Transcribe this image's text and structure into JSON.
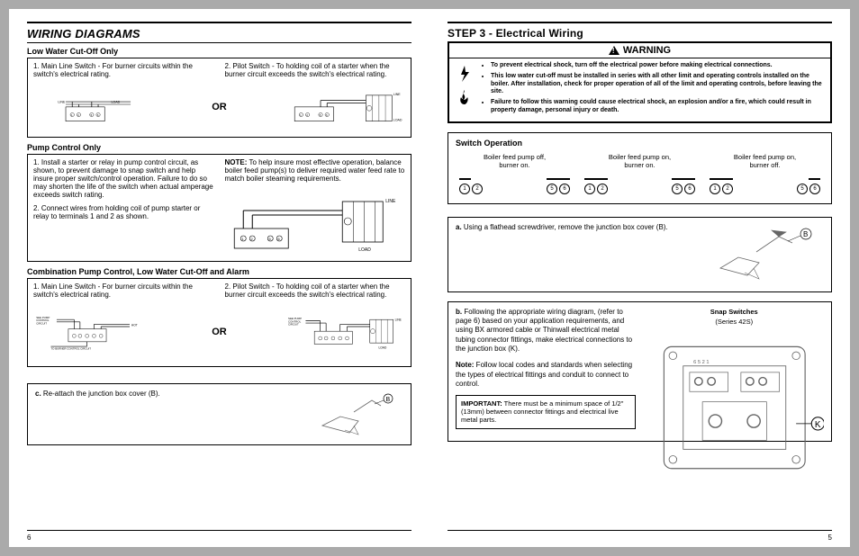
{
  "left": {
    "heading": "WIRING DIAGRAMS",
    "sec1": {
      "title": "Low Water Cut-Off Only",
      "item1": "1. Main Line Switch - For burner circuits within the switch's electrical rating.",
      "or": "OR",
      "item2": "2. Pilot Switch - To holding coil of a starter when the burner circuit exceeds the switch's electrical rating.",
      "d1_labels": {
        "line": "LINE",
        "load": "LOAD",
        "terms": "1 2     5 6"
      },
      "d2_labels": {
        "line": "LINE",
        "load": "LOAD",
        "terms": "1 2     5 6"
      }
    },
    "sec2": {
      "title": "Pump Control Only",
      "item1": "1. Install a starter or relay in pump control circuit, as shown, to prevent damage to snap switch and help insure proper switch/control operation. Failure to do so may shorten the life of the switch when actual amperage exceeds switch rating.",
      "item2": "2. Connect wires from holding coil of pump starter or relay to terminals 1 and 2 as shown.",
      "note_label": "NOTE:",
      "note": " To help insure most effective operation, balance boiler feed pump(s) to deliver required water feed rate to match boiler steaming requirements.",
      "d_labels": {
        "line": "LINE",
        "load": "LOAD",
        "terms": "1 2     5 6"
      }
    },
    "sec3": {
      "title": "Combination Pump Control, Low Water Cut-Off and Alarm",
      "item1": "1. Main Line Switch - For burner circuits within the switch's electrical rating.",
      "or": "OR",
      "item2": "2. Pilot Switch  - To holding coil of a starter when the burner circuit exceeds the switch's electrical rating.",
      "d1_labels": {
        "see": "SEE PUMP CONTROL CIRCUIT",
        "hot": "HOT",
        "to": "TO BURNER CONTROL CIRCUIT"
      },
      "d2_labels": {
        "see": "SEE PUMP CONTROL CIRCUIT",
        "line": "LINE",
        "load": "LOAD"
      }
    },
    "step_c": "c. Re-attach the junction box cover (B).",
    "page_num": "6"
  },
  "right": {
    "heading": "STEP 3 - Electrical Wiring",
    "warning_title": "WARNING",
    "warn1": "To prevent electrical shock, turn off the electrical power before making electrical connections.",
    "warn2": "This low water cut-off must be installed in series with all other limit and operating controls installed on the boiler. After installation, check for proper operation of all of the limit and operating controls, before leaving the site.",
    "warn3": "Failure to follow this warning could cause electrical shock, an explosion and/or a fire, which could result in property damage, personal injury or death.",
    "switch_op": {
      "title": "Switch Operation",
      "c1a": "Boiler feed pump off,",
      "c1b": "burner on.",
      "c2a": "Boiler feed pump on,",
      "c2b": "burner on.",
      "c3a": "Boiler feed pump on,",
      "c3b": "burner off.",
      "t12": "1 2",
      "t56": "5 6"
    },
    "step_a": {
      "label": "a.",
      "text": " Using a flathead screwdriver, remove the junction box cover (B).",
      "callout": "B"
    },
    "step_b": {
      "label": "b.",
      "text": " Following the appropriate wiring diagram, (refer to page 6) based on your application requirements, and using BX armored cable or Thinwall electrical metal tubing connector fittings, make electrical connections to the junction box (K).",
      "note_label": "Note:",
      "note": " Follow local codes and standards when selecting the types of electrical fittings and conduit to connect to control.",
      "imp_label": "IMPORTANT:",
      "imp": " There must be a minimum space of 1/2\" (13mm) between connector fittings and electrical live metal parts.",
      "snap_title1": "Snap Switches",
      "snap_title2": "(Series 42S)",
      "callout": "K"
    },
    "page_num": "5"
  }
}
